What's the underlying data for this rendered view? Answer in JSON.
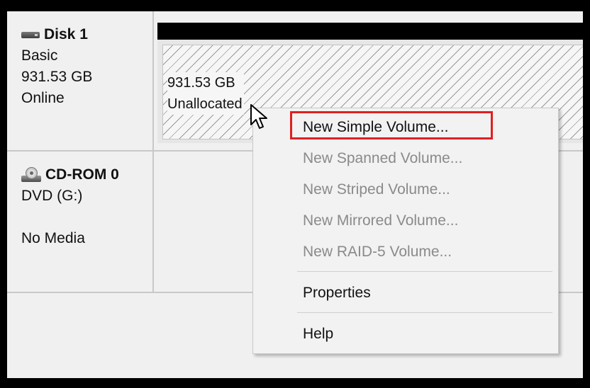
{
  "disks": [
    {
      "name": "Disk 1",
      "type": "Basic",
      "size": "931.53 GB",
      "status": "Online",
      "icon": "hard-disk-icon"
    },
    {
      "name": "CD-ROM 0",
      "type": "DVD (G:)",
      "size": "",
      "status": "No Media",
      "icon": "cd-rom-icon"
    }
  ],
  "volume": {
    "size": "931.53 GB",
    "state": "Unallocated"
  },
  "context_menu": {
    "items": [
      {
        "label": "New Simple Volume...",
        "enabled": true,
        "highlighted": true
      },
      {
        "label": "New Spanned Volume...",
        "enabled": false
      },
      {
        "label": "New Striped Volume...",
        "enabled": false
      },
      {
        "label": "New Mirrored Volume...",
        "enabled": false
      },
      {
        "label": "New RAID-5 Volume...",
        "enabled": false
      },
      {
        "label": "Properties",
        "enabled": true
      },
      {
        "label": "Help",
        "enabled": true
      }
    ]
  },
  "colors": {
    "highlight_box": "#e02020",
    "volume_header": "#000000",
    "disabled_text": "#8a8a8a"
  }
}
